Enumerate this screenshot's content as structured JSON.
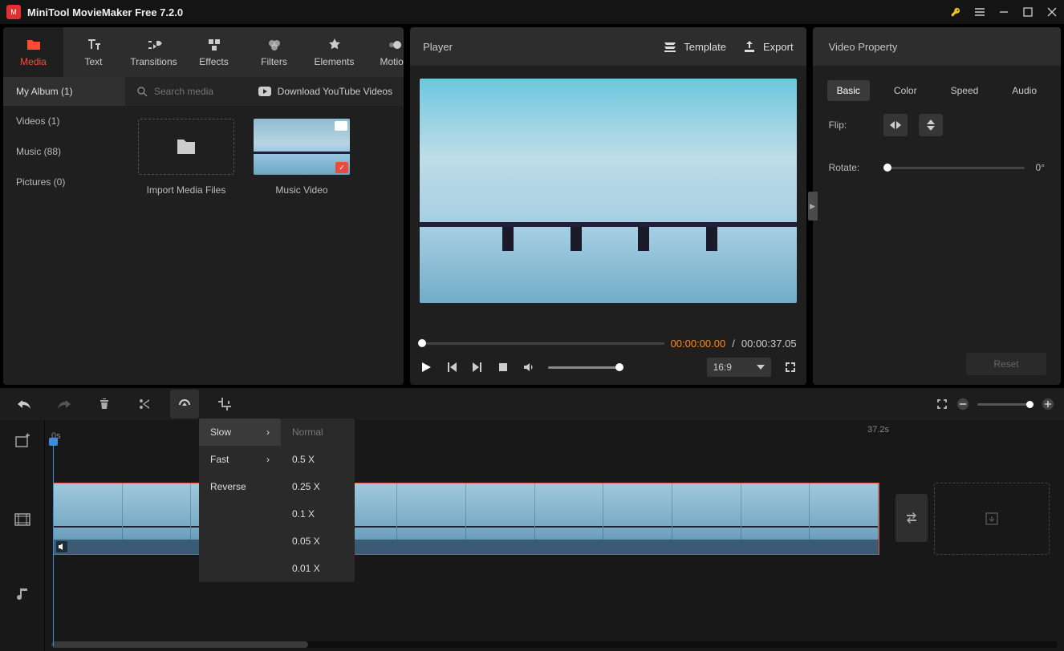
{
  "title": "MiniTool MovieMaker Free 7.2.0",
  "tabs": {
    "media": "Media",
    "text": "Text",
    "transitions": "Transitions",
    "effects": "Effects",
    "filters": "Filters",
    "elements": "Elements",
    "motion": "Motion"
  },
  "sidebar": {
    "header": "My Album (1)",
    "videos": "Videos (1)",
    "music": "Music (88)",
    "pictures": "Pictures (0)"
  },
  "search_placeholder": "Search media",
  "download_label": "Download YouTube Videos",
  "import_label": "Import Media Files",
  "clip_name": "Music Video",
  "player": {
    "title": "Player",
    "template": "Template",
    "export": "Export",
    "cur": "00:00:00.00",
    "sep": "/",
    "dur": "00:00:37.05",
    "aspect": "16:9"
  },
  "prop": {
    "title": "Video Property",
    "basic": "Basic",
    "color": "Color",
    "speed": "Speed",
    "audio": "Audio",
    "flip": "Flip:",
    "rotate": "Rotate:",
    "rot_val": "0°",
    "reset": "Reset"
  },
  "ruler": {
    "start": "0s",
    "end": "37.2s"
  },
  "menu": {
    "slow": "Slow",
    "fast": "Fast",
    "reverse": "Reverse",
    "normal": "Normal",
    "s05": "0.5 X",
    "s025": "0.25 X",
    "s01": "0.1 X",
    "s005": "0.05 X",
    "s001": "0.01 X"
  }
}
